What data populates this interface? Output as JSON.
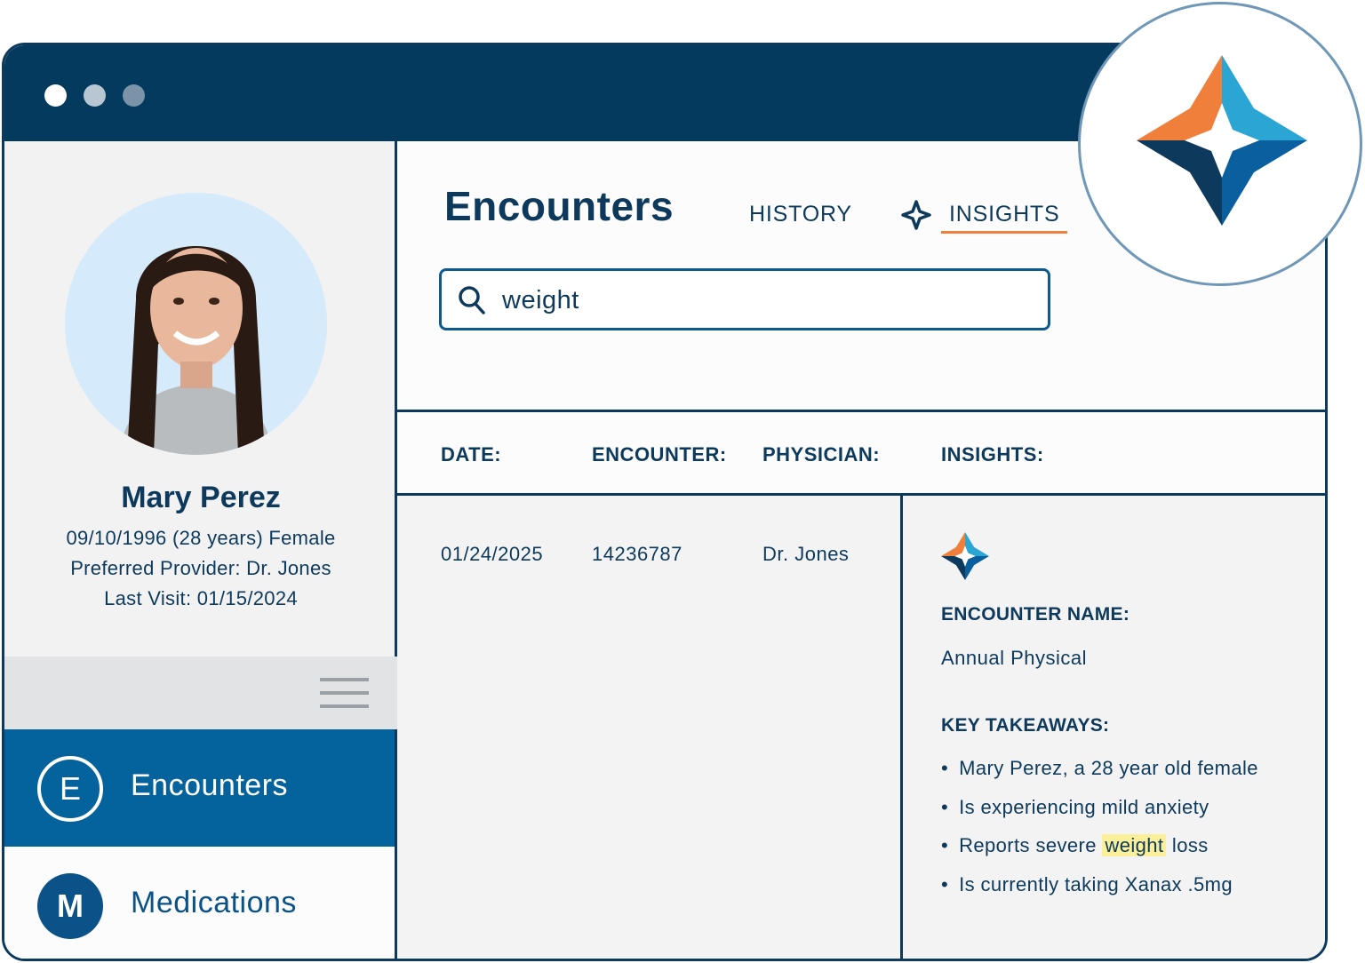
{
  "patient": {
    "name": "Mary Perez",
    "dob_line": "09/10/1996 (28 years) Female",
    "provider_line": "Preferred Provider: Dr. Jones",
    "last_visit_line": "Last Visit: 01/15/2024"
  },
  "nav": {
    "items": [
      {
        "badge": "E",
        "label": "Encounters",
        "active": true
      },
      {
        "badge": "M",
        "label": "Medications",
        "active": false
      }
    ]
  },
  "main": {
    "title": "Encounters",
    "tabs": [
      {
        "label": "HISTORY",
        "active": false
      },
      {
        "label": "INSIGHTS",
        "active": true
      }
    ],
    "search": {
      "value": "weight"
    },
    "table": {
      "headers": [
        "DATE:",
        "ENCOUNTER:",
        "PHYSICIAN:",
        "INSIGHTS:"
      ],
      "rows": [
        {
          "date": "01/24/2025",
          "encounter": "14236787",
          "physician": "Dr. Jones"
        }
      ]
    },
    "insights": {
      "name_label": "ENCOUNTER NAME:",
      "name_value": "Annual Physical",
      "takeaways_label": "KEY TAKEAWAYS:",
      "takeaways": [
        {
          "text": "Mary Perez, a 28 year old female"
        },
        {
          "text": "Is experiencing mild anxiety"
        },
        {
          "before": "Reports severe ",
          "highlight": "weight",
          "after": " loss"
        },
        {
          "text": "Is currently taking Xanax .5mg"
        }
      ]
    }
  },
  "colors": {
    "titlebar": "#043a5e",
    "navy": "#0d3a5c",
    "nav_active": "#04629c",
    "accent_orange": "#f07f3c",
    "accent_teal": "#2aa5d4",
    "highlight": "#fbef9a"
  },
  "icons": [
    "sparkle-icon",
    "search-icon",
    "hamburger-menu-icon",
    "brand-star-logo-icon"
  ]
}
